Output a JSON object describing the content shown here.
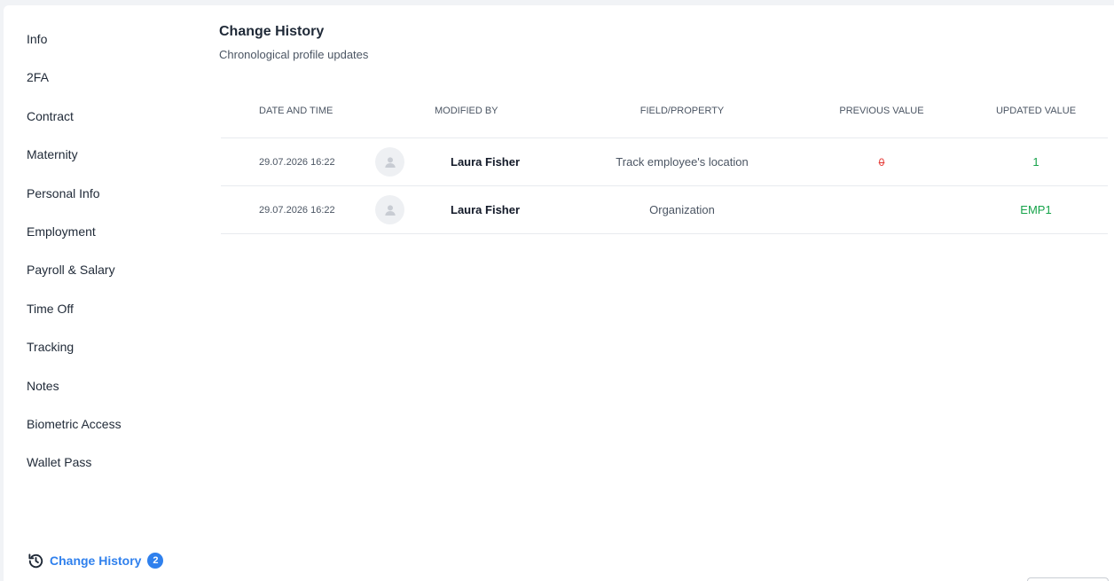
{
  "sidebar": {
    "items": [
      {
        "label": "Info"
      },
      {
        "label": "2FA"
      },
      {
        "label": "Contract"
      },
      {
        "label": "Maternity"
      },
      {
        "label": "Personal Info"
      },
      {
        "label": "Employment"
      },
      {
        "label": "Payroll & Salary"
      },
      {
        "label": "Time Off"
      },
      {
        "label": "Tracking"
      },
      {
        "label": "Notes"
      },
      {
        "label": "Biometric Access"
      },
      {
        "label": "Wallet Pass"
      }
    ],
    "history": {
      "label": "Change History",
      "badge": "2",
      "icon": "history-icon"
    }
  },
  "main": {
    "title": "Change History",
    "subtitle": "Chronological profile updates",
    "columns": {
      "date": "DATE AND TIME",
      "modified_by": "MODIFIED BY",
      "field": "FIELD/PROPERTY",
      "previous": "PREVIOUS VALUE",
      "updated": "UPDATED VALUE"
    },
    "rows": [
      {
        "date": "29.07.2026 16:22",
        "user": "Laura Fisher",
        "field": "Track employee's location",
        "previous": "0",
        "updated": "1"
      },
      {
        "date": "29.07.2026 16:22",
        "user": "Laura Fisher",
        "field": "Organization",
        "previous": "",
        "updated": "EMP1"
      }
    ]
  },
  "colors": {
    "accent": "#2f80ed",
    "removed": "#e53935",
    "added": "#16a34a"
  }
}
